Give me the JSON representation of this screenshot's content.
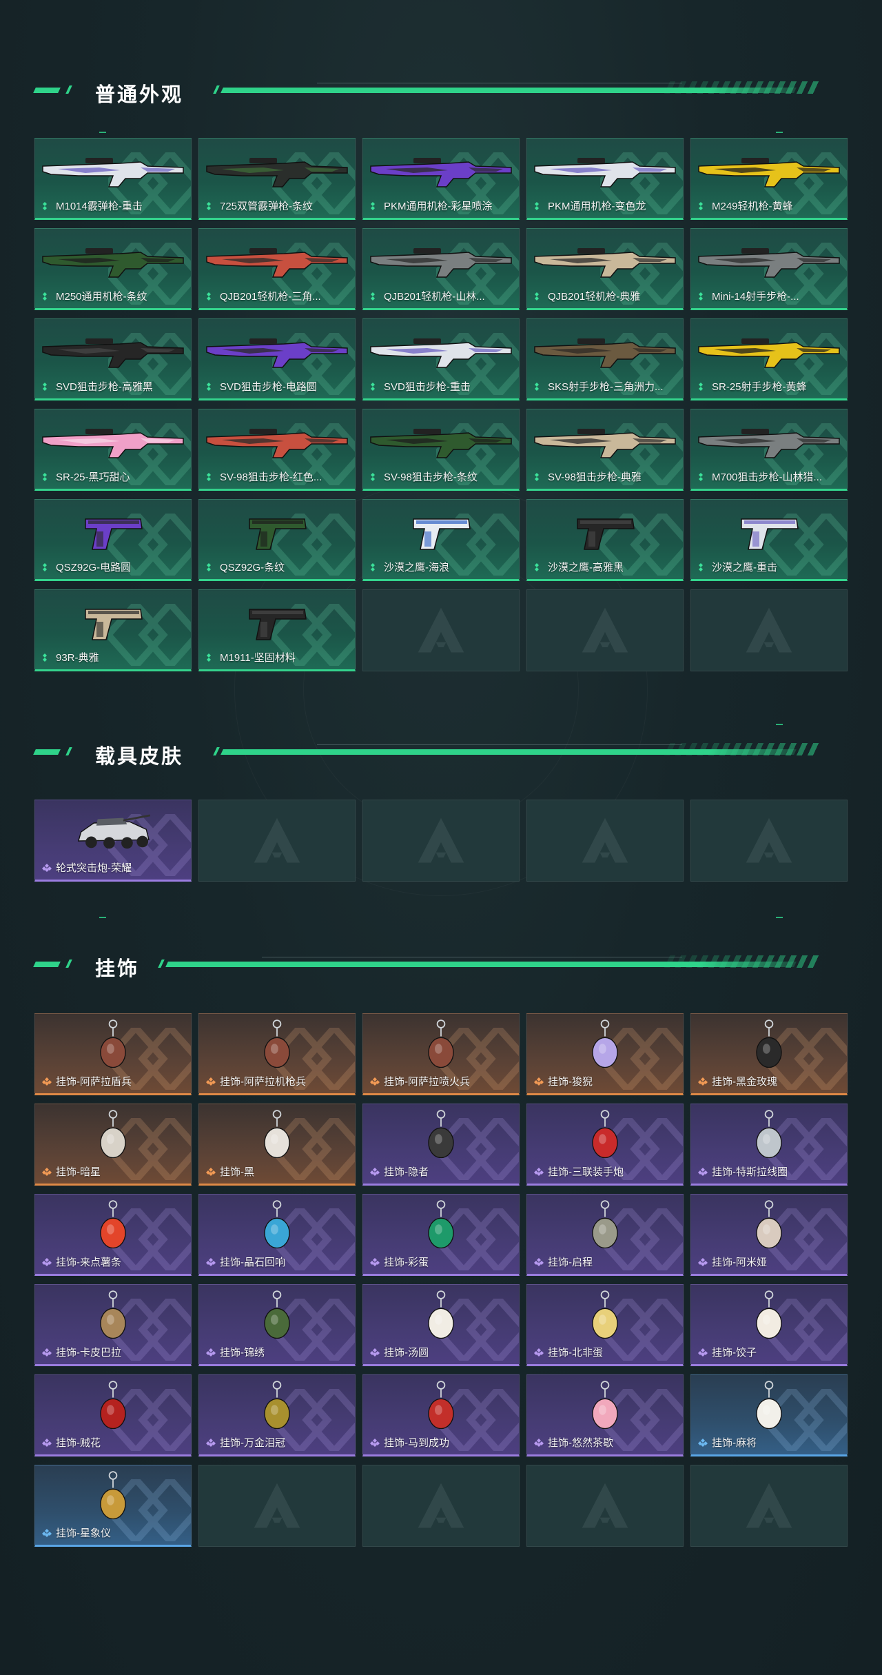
{
  "sections": {
    "weapons": {
      "title": "普通外观",
      "items": [
        {
          "name": "M1014霰弹枪-重击",
          "rarity": "green",
          "art": "gun-long-white"
        },
        {
          "name": "725双管霰弹枪-条纹",
          "rarity": "green",
          "art": "gun-shotgun-dark"
        },
        {
          "name": "PKM通用机枪-彩星喷涂",
          "rarity": "green",
          "art": "gun-mg-purple"
        },
        {
          "name": "PKM通用机枪-变色龙",
          "rarity": "green",
          "art": "gun-mg-white"
        },
        {
          "name": "M249轻机枪-黄蜂",
          "rarity": "green",
          "art": "gun-mg-yellow"
        },
        {
          "name": "M250通用机枪-条纹",
          "rarity": "green",
          "art": "gun-mg-green"
        },
        {
          "name": "QJB201轻机枪-三角...",
          "rarity": "green",
          "art": "gun-lmg-red"
        },
        {
          "name": "QJB201轻机枪-山林...",
          "rarity": "green",
          "art": "gun-lmg-grey"
        },
        {
          "name": "QJB201轻机枪-典雅",
          "rarity": "green",
          "art": "gun-lmg-tan"
        },
        {
          "name": "Mini-14射手步枪-...",
          "rarity": "green",
          "art": "gun-rifle-grey"
        },
        {
          "name": "SVD狙击步枪-高雅黑",
          "rarity": "green",
          "art": "gun-sniper-black"
        },
        {
          "name": "SVD狙击步枪-电路圆",
          "rarity": "green",
          "art": "gun-sniper-purple"
        },
        {
          "name": "SVD狙击步枪-重击",
          "rarity": "green",
          "art": "gun-sniper-white"
        },
        {
          "name": "SKS射手步枪-三角洲力...",
          "rarity": "green",
          "art": "gun-rifle-camo"
        },
        {
          "name": "SR-25射手步枪-黄蜂",
          "rarity": "green",
          "art": "gun-rifle-yellow"
        },
        {
          "name": "SR-25-黑巧甜心",
          "rarity": "green",
          "art": "gun-rifle-pink"
        },
        {
          "name": "SV-98狙击步枪-红色...",
          "rarity": "green",
          "art": "gun-sniper-red"
        },
        {
          "name": "SV-98狙击步枪-条纹",
          "rarity": "green",
          "art": "gun-sniper-green"
        },
        {
          "name": "SV-98狙击步枪-典雅",
          "rarity": "green",
          "art": "gun-sniper-tan"
        },
        {
          "name": "M700狙击步枪-山林猎...",
          "rarity": "green",
          "art": "gun-sniper-grey"
        },
        {
          "name": "QSZ92G-电路圆",
          "rarity": "green",
          "art": "pistol-purple"
        },
        {
          "name": "QSZ92G-条纹",
          "rarity": "green",
          "art": "pistol-green"
        },
        {
          "name": "沙漠之鹰-海浪",
          "rarity": "green",
          "art": "pistol-deagle-blue"
        },
        {
          "name": "沙漠之鹰-高雅黑",
          "rarity": "green",
          "art": "pistol-deagle-black"
        },
        {
          "name": "沙漠之鹰-重击",
          "rarity": "green",
          "art": "pistol-deagle-white"
        },
        {
          "name": "93R-典雅",
          "rarity": "green",
          "art": "pistol-tan"
        },
        {
          "name": "M1911-坚固材料",
          "rarity": "green",
          "art": "pistol-black"
        },
        {
          "name": "",
          "rarity": "empty"
        },
        {
          "name": "",
          "rarity": "empty"
        },
        {
          "name": "",
          "rarity": "empty"
        }
      ]
    },
    "vehicles": {
      "title": "载具皮肤",
      "items": [
        {
          "name": "轮式突击炮-荣耀",
          "rarity": "purple",
          "art": "vehicle"
        },
        {
          "name": "",
          "rarity": "empty"
        },
        {
          "name": "",
          "rarity": "empty"
        },
        {
          "name": "",
          "rarity": "empty"
        },
        {
          "name": "",
          "rarity": "empty"
        }
      ]
    },
    "charms": {
      "title": "挂饰",
      "items": [
        {
          "name": "挂饰-阿萨拉盾兵",
          "rarity": "orange",
          "art": "charm-soldier"
        },
        {
          "name": "挂饰-阿萨拉机枪兵",
          "rarity": "orange",
          "art": "charm-soldier"
        },
        {
          "name": "挂饰-阿萨拉喷火兵",
          "rarity": "orange",
          "art": "charm-soldier"
        },
        {
          "name": "挂饰-狻猊",
          "rarity": "orange",
          "art": "charm-beast"
        },
        {
          "name": "挂饰-黑金玫瑰",
          "rarity": "orange",
          "art": "charm-rose"
        },
        {
          "name": "挂饰-暗星",
          "rarity": "orange",
          "art": "charm-blade"
        },
        {
          "name": "挂饰-黑",
          "rarity": "orange",
          "art": "charm-tag"
        },
        {
          "name": "挂饰-隐者",
          "rarity": "purple",
          "art": "charm-card"
        },
        {
          "name": "挂饰-三联装手炮",
          "rarity": "purple",
          "art": "charm-red-block"
        },
        {
          "name": "挂饰-特斯拉线圈",
          "rarity": "purple",
          "art": "charm-coil"
        },
        {
          "name": "挂饰-来点薯条",
          "rarity": "purple",
          "art": "charm-fries"
        },
        {
          "name": "挂饰-晶石回响",
          "rarity": "purple",
          "art": "charm-crystal"
        },
        {
          "name": "挂饰-彩蛋",
          "rarity": "purple",
          "art": "charm-egg"
        },
        {
          "name": "挂饰-启程",
          "rarity": "purple",
          "art": "charm-orb"
        },
        {
          "name": "挂饰-阿米娅",
          "rarity": "purple",
          "art": "charm-bunny"
        },
        {
          "name": "挂饰-卡皮巴拉",
          "rarity": "purple",
          "art": "charm-capy"
        },
        {
          "name": "挂饰-锦绣",
          "rarity": "purple",
          "art": "charm-butterfly"
        },
        {
          "name": "挂饰-汤圆",
          "rarity": "purple",
          "art": "charm-bowl"
        },
        {
          "name": "挂饰-北非蛋",
          "rarity": "purple",
          "art": "charm-pan"
        },
        {
          "name": "挂饰-饺子",
          "rarity": "purple",
          "art": "charm-plate"
        },
        {
          "name": "挂饰-贼花",
          "rarity": "purple",
          "art": "charm-flower"
        },
        {
          "name": "挂饰-万金泪冠",
          "rarity": "purple",
          "art": "charm-crown"
        },
        {
          "name": "挂饰-马到成功",
          "rarity": "purple",
          "art": "charm-horse"
        },
        {
          "name": "挂饰-悠然茶歇",
          "rarity": "purple",
          "art": "charm-cupcake"
        },
        {
          "name": "挂饰-麻将",
          "rarity": "blue",
          "art": "charm-mahjong"
        },
        {
          "name": "挂饰-星象仪",
          "rarity": "blue",
          "art": "charm-astrolabe"
        },
        {
          "name": "",
          "rarity": "empty"
        },
        {
          "name": "",
          "rarity": "empty"
        },
        {
          "name": "",
          "rarity": "empty"
        },
        {
          "name": "",
          "rarity": "empty"
        }
      ]
    }
  },
  "colors": {
    "accent": "#2fd38a",
    "green_border": "#34d48d",
    "purple_border": "#9b7de0",
    "orange_border": "#e08a46",
    "blue_border": "#5aa6e6"
  }
}
